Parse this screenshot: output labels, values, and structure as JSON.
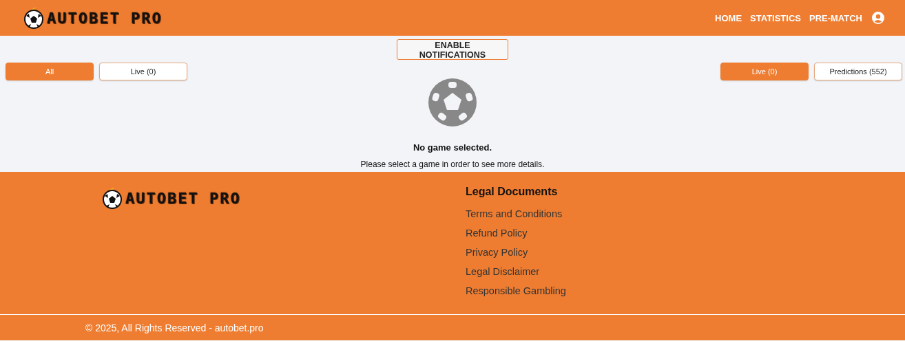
{
  "header": {
    "logo": "AUTOBET PRO",
    "nav": [
      "HOME",
      "STATISTICS",
      "PRE-MATCH"
    ]
  },
  "notify_button": "ENABLE NOTIFICATIONS",
  "filters_left": [
    {
      "label": "All",
      "selected": true
    },
    {
      "label": "Live (0)",
      "selected": false
    }
  ],
  "filters_right": [
    {
      "label": "Live (0)",
      "selected": true
    },
    {
      "label": "Predictions (552)",
      "selected": false
    }
  ],
  "empty_state": {
    "title": "No game selected.",
    "message": "Please select a game in order to see more details."
  },
  "footer": {
    "logo": "AUTOBET PRO",
    "legal": {
      "heading": "Legal Documents",
      "links": [
        "Terms and Conditions",
        "Refund Policy",
        "Privacy Policy",
        "Legal Disclaimer",
        "Responsible Gambling"
      ]
    },
    "copyright": "© 2025, All Rights Reserved - autobet.pro"
  }
}
